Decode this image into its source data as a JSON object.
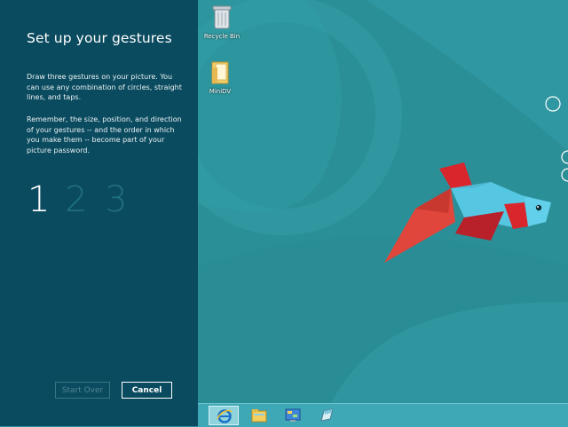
{
  "setup_panel": {
    "title": "Set up your gestures",
    "instructions_1": "Draw three gestures on your picture. You can use any combination of circles, straight lines, and taps.",
    "instructions_2": "Remember, the size, position, and direction of your gestures -- and the order in which you make them -- become part of your picture password.",
    "steps": [
      "1",
      "2",
      "3"
    ],
    "current_step": 1,
    "start_over_label": "Start Over",
    "cancel_label": "Cancel"
  },
  "desktop": {
    "icons": [
      {
        "label": "Recycle Bin",
        "icon": "recycle-bin-icon"
      },
      {
        "label": "MiniDV",
        "icon": "folder-icon"
      }
    ]
  },
  "taskbar": {
    "pinned": [
      {
        "name": "internet-explorer-icon",
        "active": true
      },
      {
        "name": "file-explorer-icon",
        "active": false
      },
      {
        "name": "control-panel-icon",
        "active": false
      },
      {
        "name": "paint-icon",
        "active": false
      }
    ]
  },
  "colors": {
    "panel_bg": "#0b4b5f",
    "desktop_bg": "#2a8e97",
    "step_active": "#ffffff",
    "step_inactive": "#1f6f80",
    "taskbar_bg": "#3fa8b7"
  }
}
